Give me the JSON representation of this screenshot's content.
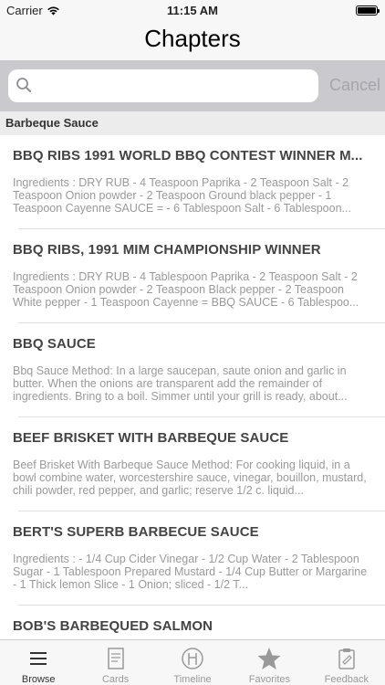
{
  "status": {
    "carrier": "Carrier",
    "time": "11:15 AM"
  },
  "nav": {
    "title": "Chapters"
  },
  "search": {
    "placeholder": "",
    "cancel_label": "Cancel"
  },
  "section": {
    "title": "Barbeque Sauce"
  },
  "recipes": [
    {
      "title": "BBQ RIBS 1991 WORLD BBQ CONTEST WINNER M...",
      "description": "Ingredients : DRY RUB - 4 Teaspoon Paprika - 2 Teaspoon Salt - 2 Teaspoon Onion powder - 2 Teaspoon Ground black pepper - 1 Teaspoon Cayenne SAUCE = - 6 Tablespoon Salt - 6 Tablespoon..."
    },
    {
      "title": "BBQ RIBS, 1991 MIM CHAMPIONSHIP WINNER",
      "description": "Ingredients : DRY RUB - 4 Tablespoon Paprika - 2 Teaspoon Salt - 2 Teaspoon Onion powder - 2 Teaspoon Black pepper - 2 Teaspoon White pepper - 1 Teaspoon Cayenne = BBQ SAUCE - 6 Tablespoo..."
    },
    {
      "title": "BBQ SAUCE",
      "description": "Bbq Sauce Method: In a large saucepan, saute onion and garlic in butter. When the onions are transparent add the remainder of ingredients. Bring to a boil. Simmer until your grill is ready, about..."
    },
    {
      "title": "BEEF BRISKET WITH BARBEQUE SAUCE",
      "description": "Beef Brisket With Barbeque Sauce Method: For cooking liquid, in a bowl combine water, worcestershire sauce, vinegar, bouillon, mustard, chili powder, red pepper, and garlic; reserve 1/2 c. liquid..."
    },
    {
      "title": "BERT'S SUPERB BARBECUE SAUCE",
      "description": "Ingredients : - 1/4 Cup Cider Vinegar - 1/2 Cup Water - 2 Tablespoon Sugar - 1 Tablespoon Prepared Mustard - 1/4 Cup Butter or Margarine - 1 Thick lemon Slice - 1 Onion; sliced - 1/2 T..."
    },
    {
      "title": "BOB'S BARBEQUED SALMON",
      "description": ""
    }
  ],
  "tabs": [
    {
      "label": "Browse",
      "icon": "browse-icon"
    },
    {
      "label": "Cards",
      "icon": "cards-icon"
    },
    {
      "label": "Timeline",
      "icon": "timeline-icon"
    },
    {
      "label": "Favorites",
      "icon": "star-icon"
    },
    {
      "label": "Feedback",
      "icon": "feedback-icon"
    }
  ]
}
